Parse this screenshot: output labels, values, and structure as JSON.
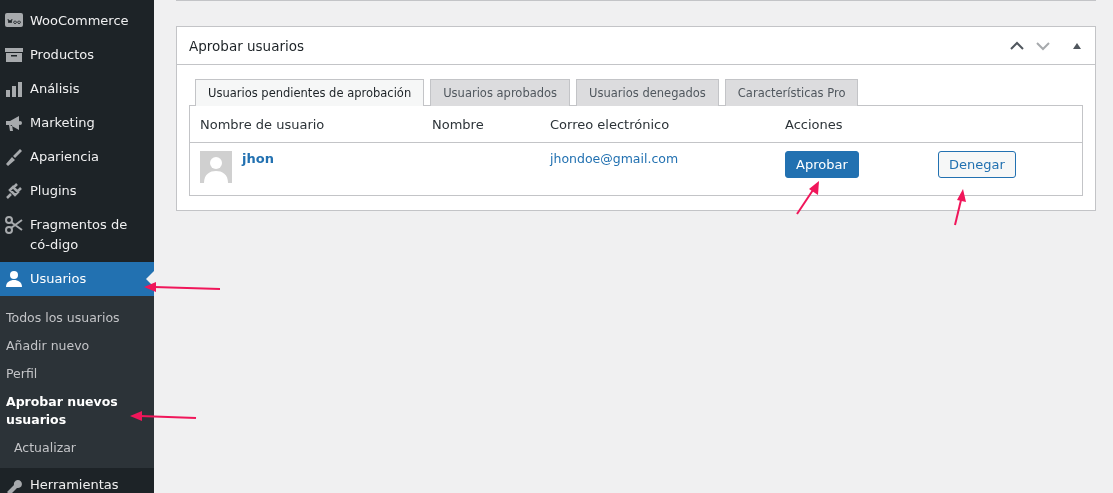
{
  "sidebar": {
    "items": [
      {
        "label": "WooCommerce",
        "selected": false
      },
      {
        "label": "Productos",
        "selected": false
      },
      {
        "label": "Análisis",
        "selected": false
      },
      {
        "label": "Marketing",
        "selected": false
      },
      {
        "label": "Apariencia",
        "selected": false
      },
      {
        "label": "Plugins",
        "selected": false
      },
      {
        "label": "Fragmentos de có-digo",
        "selected": false
      },
      {
        "label": "Usuarios",
        "selected": true,
        "children": [
          {
            "label": "Todos los usuarios",
            "selected": false
          },
          {
            "label": "Añadir nuevo",
            "selected": false
          },
          {
            "label": "Perfil",
            "selected": false
          },
          {
            "label": "Aprobar nuevos usuarios",
            "selected": true
          },
          {
            "label": "Actualizar",
            "selected": false
          }
        ]
      },
      {
        "label": "Herramientas",
        "selected": false
      }
    ]
  },
  "panel": {
    "title": "Aprobar usuarios",
    "tabs": [
      {
        "label": "Usuarios pendientes de aprobación",
        "selected": true
      },
      {
        "label": "Usuarios aprobados",
        "selected": false
      },
      {
        "label": "Usuarios denegados",
        "selected": false
      },
      {
        "label": "Características Pro",
        "selected": false
      }
    ],
    "table": {
      "columns": [
        "Nombre de usuario",
        "Nombre",
        "Correo electrónico",
        "Acciones"
      ],
      "rows": [
        {
          "username": "jhon",
          "email": "jhondoe@gmail.com",
          "approve": "Aprobar",
          "deny": "Denegar"
        }
      ]
    }
  }
}
